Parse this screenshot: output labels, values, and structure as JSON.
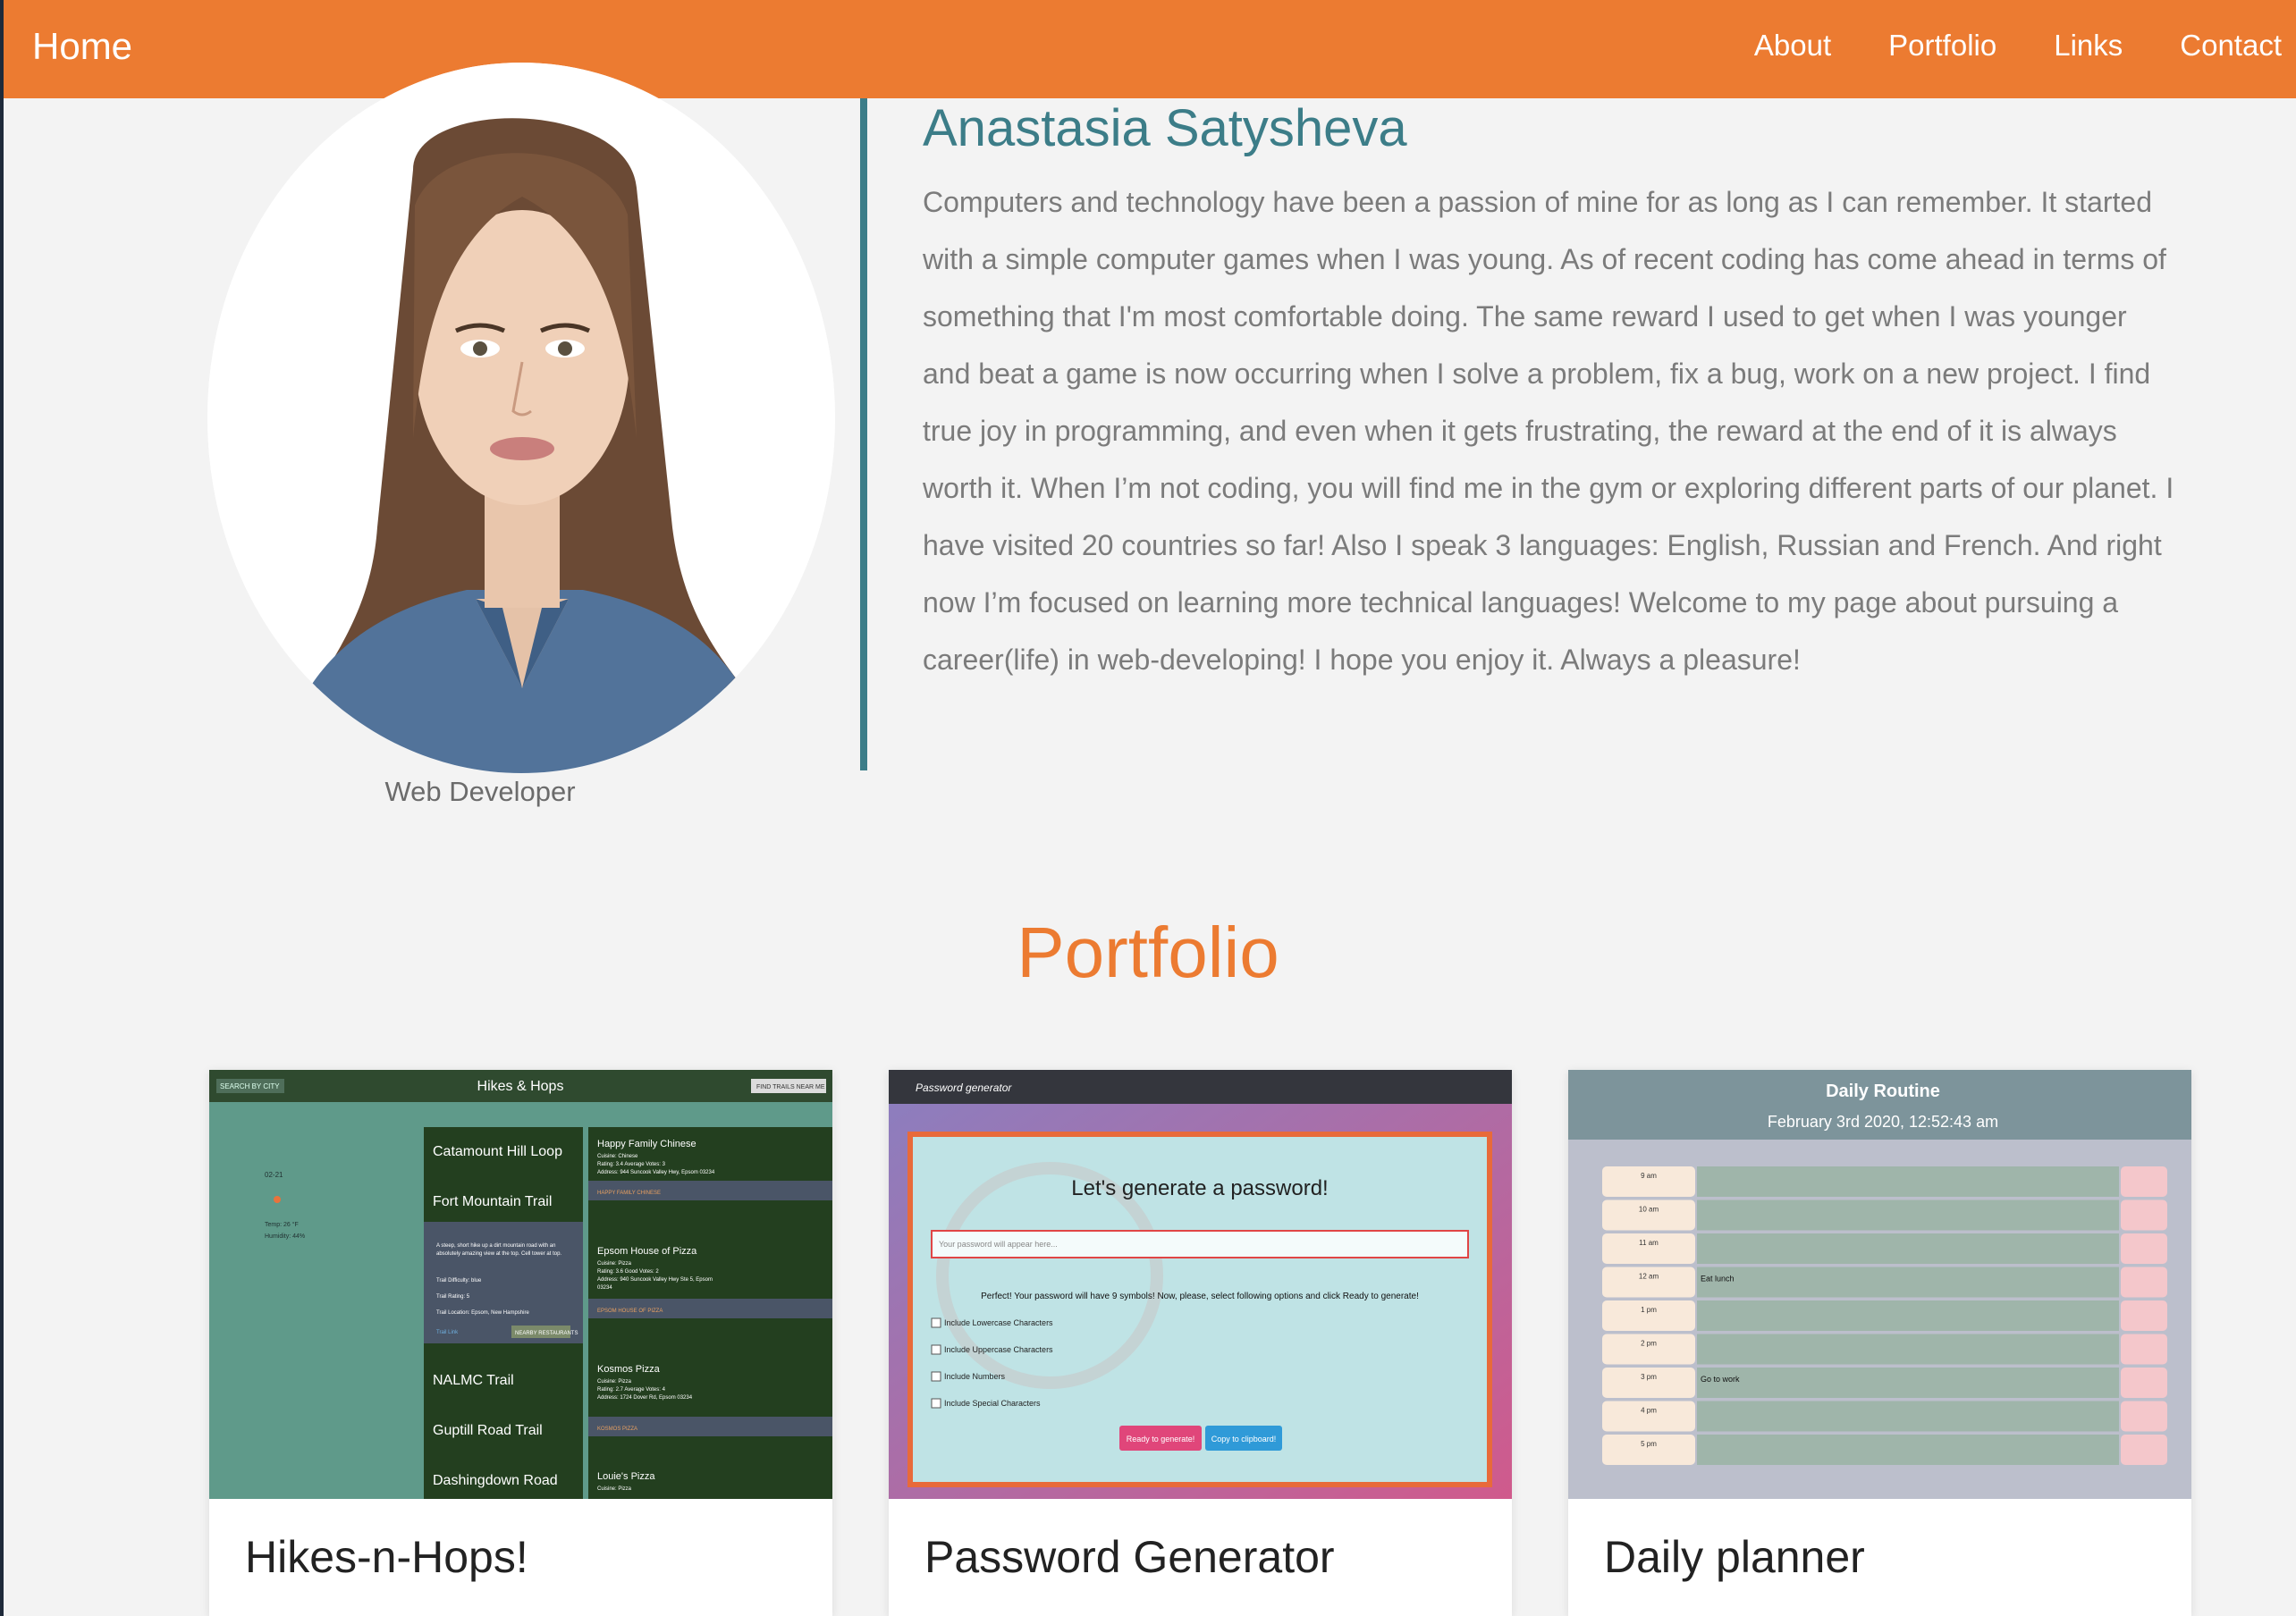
{
  "nav": {
    "brand": "Home",
    "links": [
      "About",
      "Portfolio",
      "Links",
      "Contact"
    ]
  },
  "about": {
    "name": "Anastasia Satysheva",
    "role": "Web Developer",
    "bio": "Computers and technology have been a passion of mine for as long as I can remember. It started with a simple computer games when I was young. As of recent coding has come ahead in terms of something that I'm most comfortable doing. The same reward I used to get when I was younger and beat a game is now occurring when I solve a problem, fix a bug, work on a new project. I find true joy in programming, and even when it gets frustrating, the reward at the end of it is always worth it. When I’m not coding, you will find me in the gym or exploring different parts of our planet. I have visited 20 countries so far! Also I speak 3 languages: English, Russian and French. And right now I’m focused on learning more technical languages! Welcome to my page about pursuing a career(life) in web-developing! I hope you enjoy it. Always a pleasure!"
  },
  "portfolio": {
    "title": "Portfolio",
    "cards": [
      {
        "title": "Hikes-n-Hops!",
        "thumb": {
          "header": "Hikes & Hops",
          "search_label": "SEARCH BY CITY",
          "find_label": "FIND TRAILS NEAR ME",
          "weather_date": "02-21",
          "weather_temp": "Temp: 26 °F",
          "weather_humidity": "Humidity: 44%",
          "trails": [
            "Catamount Hill Loop",
            "Fort Mountain Trail",
            "NALMC Trail",
            "Guptill Road Trail",
            "Dashingdown Road"
          ],
          "trail_detail": [
            "A steep, short hike up a dirt mountain road with an",
            "absolutely amazing view at the top. Cell tower at top.",
            "Trail Difficulty: blue",
            "Trail Rating: 5",
            "Trail Location: Epsom, New Hampshire",
            "Trail Link",
            "NEARBY RESTAURANTS"
          ],
          "restaurants": [
            {
              "name": "Happy Family Chinese",
              "lines": [
                "Cuisine: Chinese",
                "Rating: 3.4 Average Votes: 3",
                "Address: 944 Suncook Valley Hwy, Epsom 03234"
              ],
              "tag": "HAPPY FAMILY CHINESE"
            },
            {
              "name": "Epsom House of Pizza",
              "lines": [
                "Cuisine: Pizza",
                "Rating: 3.6 Good Votes: 2",
                "Address: 940 Suncook Valley Hwy Ste 5, Epsom",
                "03234"
              ],
              "tag": "EPSOM HOUSE OF PIZZA"
            },
            {
              "name": "Kosmos Pizza",
              "lines": [
                "Cuisine: Pizza",
                "Rating: 2.7 Average Votes: 4",
                "Address: 1724 Dover Rd, Epsom 03234"
              ],
              "tag": "KOSMOS PIZZA"
            },
            {
              "name": "Louie's Pizza",
              "lines": [
                "Cuisine: Pizza"
              ],
              "tag": ""
            }
          ]
        }
      },
      {
        "title": "Password Generator",
        "thumb": {
          "header": "Password generator",
          "heading": "Let's generate a password!",
          "placeholder": "Your password will appear here...",
          "message": "Perfect! Your password will have 9 symbols! Now, please, select following options and click Ready to generate!",
          "options": [
            "Include Lowercase Characters",
            "Include Uppercase Characters",
            "Include Numbers",
            "Include Special Characters"
          ],
          "generate_label": "Ready to generate!",
          "copy_label": "Copy to clipboard!"
        }
      },
      {
        "title": "Daily planner",
        "thumb": {
          "header": "Daily Routine",
          "date": "February 3rd 2020, 12:52:43 am",
          "hours": [
            "9 am",
            "10 am",
            "11 am",
            "12 am",
            "1 pm",
            "2 pm",
            "3 pm",
            "4 pm",
            "5 pm"
          ],
          "entries": [
            "",
            "",
            "",
            "Eat lunch",
            "",
            "",
            "Go to work",
            "",
            ""
          ]
        }
      }
    ]
  },
  "colors": {
    "accent": "#ec7b31",
    "teal": "#3c7d88",
    "text": "#7b7b7b"
  }
}
